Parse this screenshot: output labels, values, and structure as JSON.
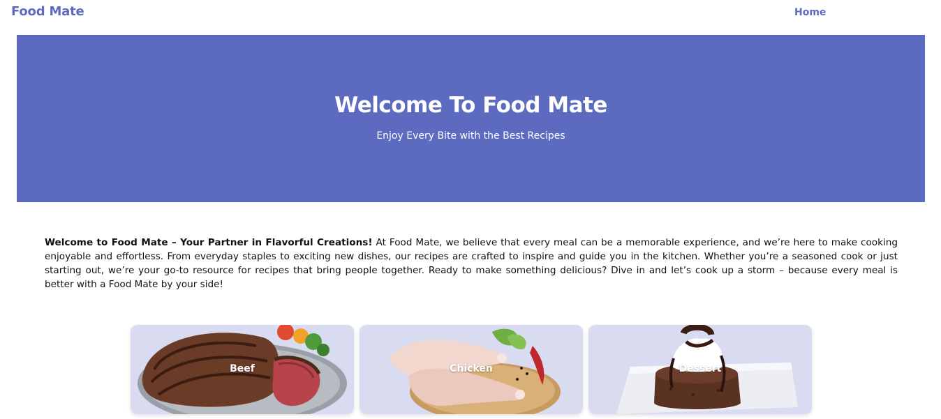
{
  "nav": {
    "brand": "Food Mate",
    "links": [
      "Home"
    ]
  },
  "hero": {
    "title": "Welcome To Food Mate",
    "subtitle": "Enjoy Every Bite with the Best Recipes"
  },
  "intro": {
    "lead": "Welcome to Food Mate – Your Partner in Flavorful Creations!",
    "body": " At Food Mate, we believe that every meal can be a memorable experience, and we’re here to make cooking enjoyable and effortless. From everyday staples to exciting new dishes, our recipes are crafted to inspire and guide you in the kitchen. Whether you’re a seasoned cook or just starting out, we’re your go-to resource for recipes that bring people together. Ready to make something delicious? Dive in and let’s cook up a storm – because every meal is better with a Food Mate by your side!"
  },
  "categories": [
    {
      "label": "Beef",
      "icon": "steak-image"
    },
    {
      "label": "Chicken",
      "icon": "chicken-legs-image"
    },
    {
      "label": "Dessert",
      "icon": "chocolate-cake-image"
    }
  ],
  "colors": {
    "accent": "#5c6bc0",
    "card_bg": "#d9dbf0"
  }
}
